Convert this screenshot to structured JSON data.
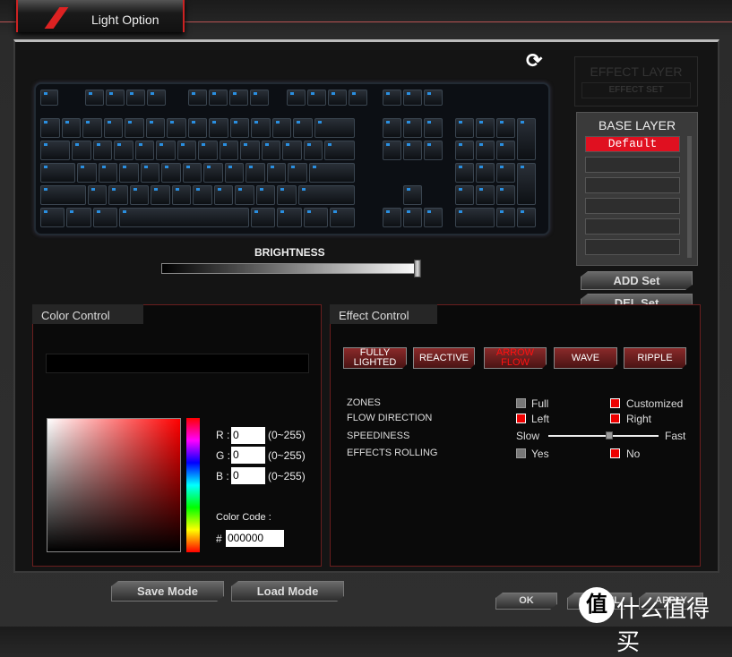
{
  "window": {
    "tab_title": "Light Option"
  },
  "keyboard": {
    "refresh_icon": "refresh-icon",
    "brightness_label": "BRIGHTNESS",
    "brightness_percent": 100
  },
  "layers": {
    "effect_layer_title": "EFFECT LAYER",
    "effect_set_label": "EFFECT SET",
    "base_layer_title": "BASE LAYER",
    "base_items": [
      "Default",
      "",
      "",
      "",
      "",
      ""
    ],
    "selected": "Default",
    "add_set": "ADD Set",
    "del_set": "DEL Set"
  },
  "color_control": {
    "title": "Color Control",
    "r_label": "R :",
    "g_label": "G :",
    "b_label": "B :",
    "r": "0",
    "g": "0",
    "b": "0",
    "range": "(0~255)",
    "color_code_label": "Color Code :",
    "hash": "#",
    "color_code": "000000"
  },
  "effect_control": {
    "title": "Effect Control",
    "effects": [
      "FULLY LIGHTED",
      "REACTIVE",
      "ARROW FLOW",
      "WAVE",
      "RIPPLE"
    ],
    "active_effect": "ARROW FLOW",
    "rows": {
      "zones": "ZONES",
      "flow": "FLOW DIRECTION",
      "speed": "SPEEDINESS",
      "rolling": "EFFECTS ROLLING"
    },
    "options": {
      "full": "Full",
      "customized": "Customized",
      "left": "Left",
      "right": "Right",
      "slow": "Slow",
      "fast": "Fast",
      "yes": "Yes",
      "no": "No"
    },
    "speed_fraction": 0.55
  },
  "footer": {
    "save_mode": "Save Mode",
    "load_mode": "Load Mode",
    "ok": "OK",
    "cancel": "CANCEL",
    "apply": "APPLY"
  },
  "watermark": {
    "logo": "值",
    "text": "什么值得买"
  },
  "colors": {
    "accent": "#e01020"
  }
}
